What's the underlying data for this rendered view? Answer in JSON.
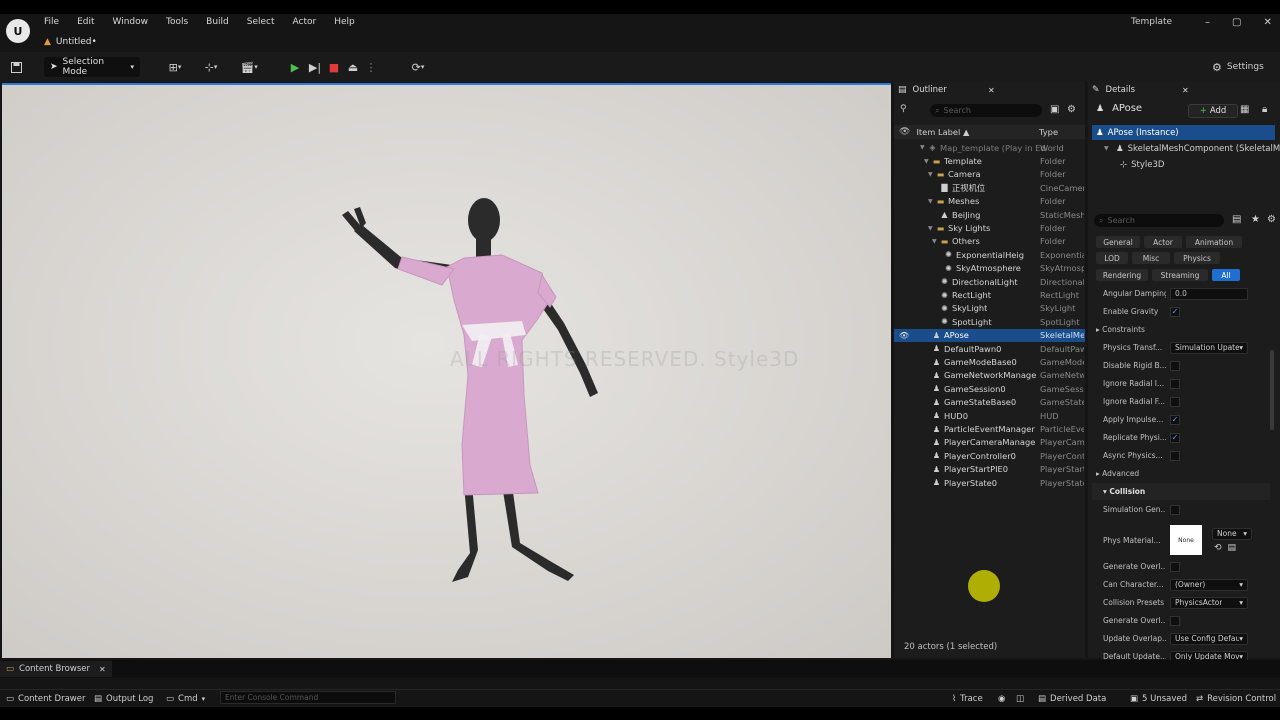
{
  "window": {
    "title": "Template",
    "minimize": "–",
    "maximize": "▢",
    "close": "✕"
  },
  "menu": [
    "File",
    "Edit",
    "Window",
    "Tools",
    "Build",
    "Select",
    "Actor",
    "Help"
  ],
  "level_tab": {
    "label": "Untitled•"
  },
  "toolbar": {
    "selection_mode": "Selection Mode",
    "settings": "Settings"
  },
  "viewport": {
    "watermark": "ALL RIGHTS RESERVED.  Style3D"
  },
  "outliner": {
    "tab_label": "Outliner",
    "search_placeholder": "Search",
    "col_label": "Item Label ▲",
    "col_type": "Type",
    "rows": [
      {
        "label": "Map_template (Play in Ed",
        "type": "World"
      },
      {
        "label": "Template",
        "type": "Folder"
      },
      {
        "label": "Camera",
        "type": "Folder"
      },
      {
        "label": "正视机位",
        "type": "CineCamera"
      },
      {
        "label": "Meshes",
        "type": "Folder"
      },
      {
        "label": "BeiJing",
        "type": "StaticMesh"
      },
      {
        "label": "Sky Lights",
        "type": "Folder"
      },
      {
        "label": "Others",
        "type": "Folder"
      },
      {
        "label": "ExponentialHeig",
        "type": "Exponential"
      },
      {
        "label": "SkyAtmosphere",
        "type": "SkyAtmosp"
      },
      {
        "label": "DirectionalLight",
        "type": "Directional"
      },
      {
        "label": "RectLight",
        "type": "RectLight"
      },
      {
        "label": "SkyLight",
        "type": "SkyLight"
      },
      {
        "label": "SpotLight",
        "type": "SpotLight"
      },
      {
        "label": "APose",
        "type": "SkeletalMe"
      },
      {
        "label": "DefaultPawn0",
        "type": "DefaultPaw"
      },
      {
        "label": "GameModeBase0",
        "type": "GameMode"
      },
      {
        "label": "GameNetworkManage",
        "type": "GameNetwo"
      },
      {
        "label": "GameSession0",
        "type": "GameSessi"
      },
      {
        "label": "GameStateBase0",
        "type": "GameState"
      },
      {
        "label": "HUD0",
        "type": "HUD"
      },
      {
        "label": "ParticleEventManager",
        "type": "ParticleEve"
      },
      {
        "label": "PlayerCameraManage",
        "type": "PlayerCame"
      },
      {
        "label": "PlayerController0",
        "type": "PlayerContr"
      },
      {
        "label": "PlayerStartPIE0",
        "type": "PlayerStart"
      },
      {
        "label": "PlayerState0",
        "type": "PlayerState"
      }
    ],
    "footer": "20 actors (1 selected)"
  },
  "details": {
    "tab_label": "Details",
    "actor_name": "APose",
    "add_label": "Add",
    "components": [
      "APose (Instance)",
      "SkeletalMeshComponent (SkeletalMes",
      "Style3D"
    ],
    "search_placeholder": "Search",
    "filters": [
      "General",
      "Actor",
      "Animation",
      "LOD",
      "Misc",
      "Physics",
      "Rendering",
      "Streaming",
      "All"
    ],
    "props": [
      {
        "name": "Angular Damping",
        "kind": "num",
        "value": "0.0"
      },
      {
        "name": "Enable Gravity",
        "kind": "chk",
        "value": "✓"
      },
      {
        "name": "Constraints",
        "kind": "cat",
        "value": ""
      },
      {
        "name": "Physics Transf...",
        "kind": "dd",
        "value": "Simulation Upater"
      },
      {
        "name": "Disable Rigid B...",
        "kind": "chk",
        "value": ""
      },
      {
        "name": "Ignore Radial I...",
        "kind": "chk",
        "value": ""
      },
      {
        "name": "Ignore Radial F...",
        "kind": "chk",
        "value": ""
      },
      {
        "name": "Apply Impulse...",
        "kind": "chk",
        "value": "✓"
      },
      {
        "name": "Replicate Physi...",
        "kind": "chk",
        "value": "✓"
      },
      {
        "name": "Async Physics...",
        "kind": "chk",
        "value": ""
      },
      {
        "name": "Advanced",
        "kind": "cat",
        "value": ""
      },
      {
        "name": "Collision",
        "kind": "section",
        "value": ""
      },
      {
        "name": "Simulation Gen...",
        "kind": "chk",
        "value": ""
      }
    ],
    "phys_material": {
      "name": "Phys Material...",
      "thumb": "None",
      "dd": "None"
    },
    "props2": [
      {
        "name": "Generate Overl...",
        "kind": "chk",
        "value": ""
      },
      {
        "name": "Can Character...",
        "kind": "dd",
        "value": "(Owner)"
      },
      {
        "name": "Collision Presets",
        "kind": "dd",
        "value": "PhysicsActor"
      },
      {
        "name": "Generate Overl...",
        "kind": "chk",
        "value": ""
      },
      {
        "name": "Update Overlap...",
        "kind": "dd",
        "value": "Use Config Defaul"
      },
      {
        "name": "Default Update...",
        "kind": "dd",
        "value": "Only Update Mov"
      }
    ]
  },
  "bottom": {
    "content_browser": "Content Browser",
    "content_drawer": "Content Drawer",
    "output_log": "Output Log",
    "cmd": "Cmd",
    "console_placeholder": "Enter Console Command",
    "trace": "Trace",
    "derived_data": "Derived Data",
    "unsaved": "5 Unsaved",
    "revision_control": "Revision Control"
  },
  "colors": {
    "accent": "#1f6fd1",
    "selection": "#1a4d8c",
    "play": "#4cc24c",
    "stop": "#e03a3a",
    "dress": "#d9a9cf"
  }
}
